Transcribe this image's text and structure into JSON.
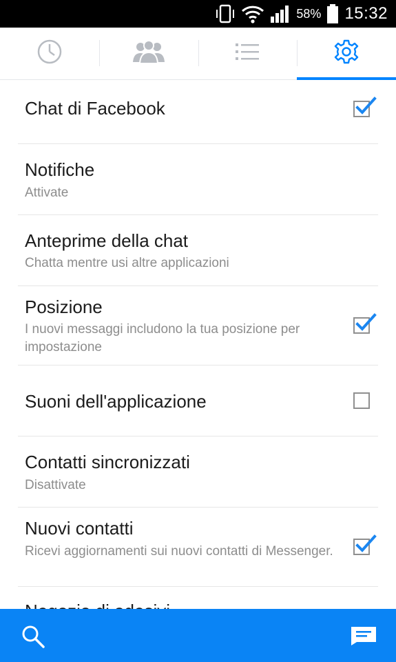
{
  "status_bar": {
    "battery_percent": "58%",
    "time": "15:32",
    "icons": [
      "vibrate-icon",
      "wifi-icon",
      "signal-icon",
      "battery-icon"
    ]
  },
  "tabs": [
    {
      "icon": "clock-icon",
      "label": "Recent"
    },
    {
      "icon": "people-icon",
      "label": "People"
    },
    {
      "icon": "list-icon",
      "label": "Groups"
    },
    {
      "icon": "gear-icon",
      "label": "Settings",
      "active": true
    }
  ],
  "settings": {
    "items": [
      {
        "title": "Chat di Facebook",
        "subtitle": "",
        "checkbox": true,
        "checked": true
      },
      {
        "title": "Notifiche",
        "subtitle": "Attivate"
      },
      {
        "title": "Anteprime della chat",
        "subtitle": "Chatta mentre usi altre applicazioni"
      },
      {
        "title": "Posizione",
        "subtitle": "I nuovi messaggi includono la tua posizione per impostazione",
        "checkbox": true,
        "checked": true
      },
      {
        "title": "Suoni dell'applicazione",
        "subtitle": "",
        "checkbox": true,
        "checked": false
      },
      {
        "title": "Contatti sincronizzati",
        "subtitle": "Disattivate"
      },
      {
        "title": "Nuovi contatti",
        "subtitle": "Ricevi aggiornamenti sui nuovi contatti di Messenger.",
        "checkbox": true,
        "checked": true
      },
      {
        "title": "Negozio di adesivi",
        "subtitle": ""
      }
    ]
  },
  "bottom_bar": {
    "search_icon": "search-icon",
    "compose_icon": "new-message-icon"
  },
  "colors": {
    "accent": "#0084ff",
    "bottom_bar": "#0a84f5",
    "text": "#1b1b1b",
    "subtext": "#8d8d8d"
  }
}
